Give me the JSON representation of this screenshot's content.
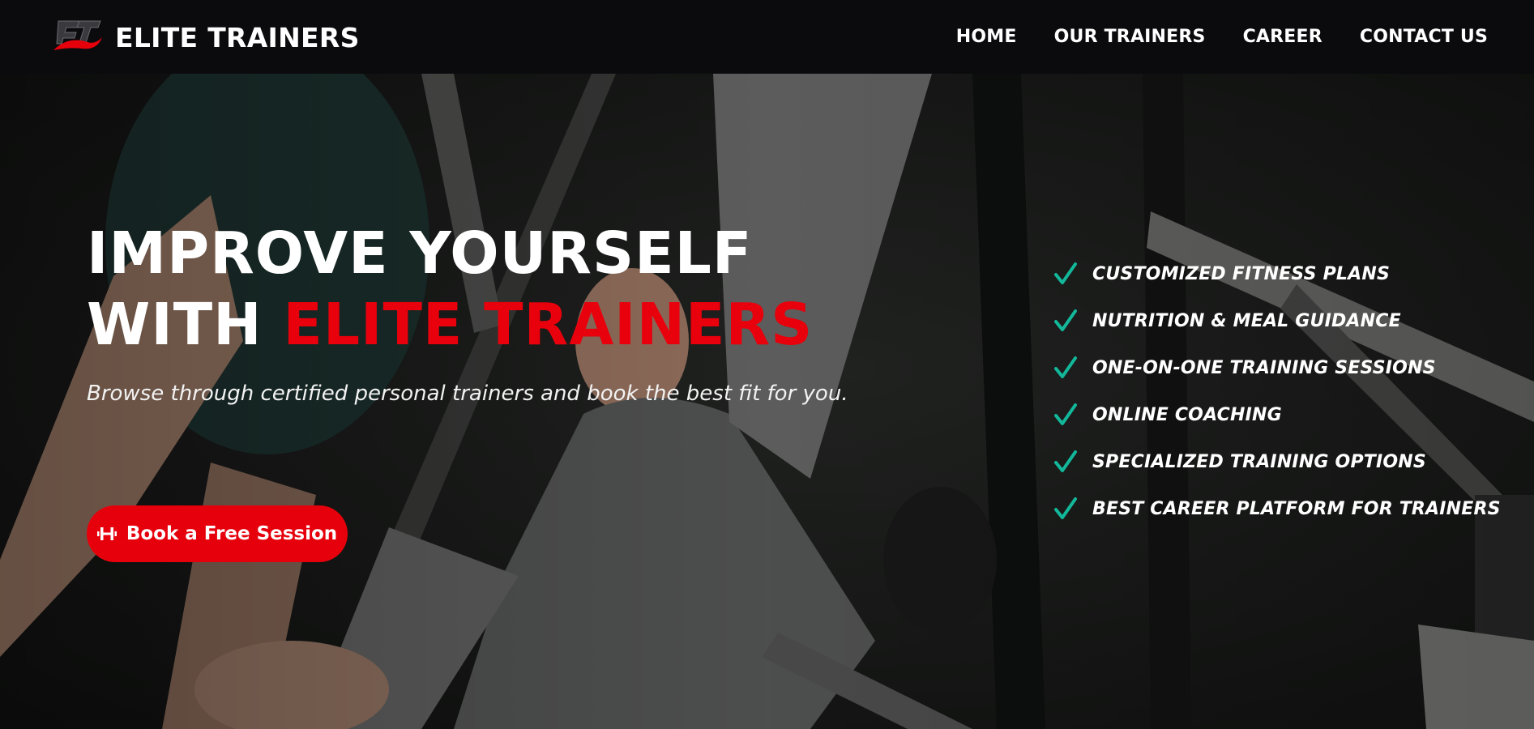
{
  "brand": {
    "name": "ELITE TRAINERS"
  },
  "nav": {
    "items": [
      {
        "label": "HOME"
      },
      {
        "label": "OUR TRAINERS"
      },
      {
        "label": "CAREER"
      },
      {
        "label": "CONTACT US"
      }
    ]
  },
  "hero": {
    "headline_line1": "IMPROVE YOURSELF",
    "headline_line2_prefix": "WITH ",
    "headline_line2_accent": "ELITE TRAINERS",
    "subtitle": "Browse through certified personal trainers and book the best fit for you.",
    "cta": {
      "label": "Book a Free Session",
      "icon": "dumbbell-icon"
    }
  },
  "features": [
    {
      "label": "CUSTOMIZED FITNESS PLANS",
      "icon": "check-icon"
    },
    {
      "label": "NUTRITION & MEAL GUIDANCE",
      "icon": "check-icon"
    },
    {
      "label": "ONE-ON-ONE TRAINING SESSIONS",
      "icon": "check-icon"
    },
    {
      "label": "ONLINE COACHING",
      "icon": "check-icon"
    },
    {
      "label": "SPECIALIZED TRAINING OPTIONS",
      "icon": "check-icon"
    },
    {
      "label": "BEST CAREER PLATFORM FOR TRAINERS",
      "icon": "check-icon"
    }
  ],
  "colors": {
    "accent": "#e6000c",
    "check": "#13b89a",
    "navbar": "#0b0b0e"
  }
}
